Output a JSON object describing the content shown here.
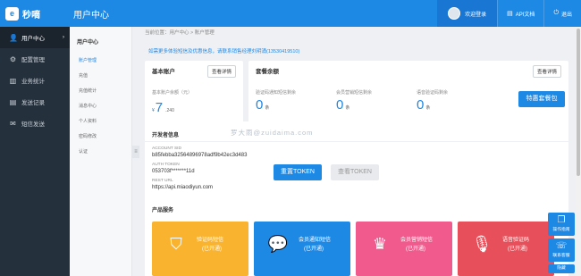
{
  "header": {
    "brand": "秒嘀",
    "logo_letter": "e",
    "title": "用户中心",
    "user_label": "欢迎登录",
    "api_label": "API文档",
    "logout_label": "退出",
    "bg_color": "#1e88e5"
  },
  "sidebar": {
    "items": [
      {
        "label": "用户中心",
        "icon": "user-icon"
      },
      {
        "label": "配置管理",
        "icon": "gear-icon"
      },
      {
        "label": "业务统计",
        "icon": "chart-icon"
      },
      {
        "label": "发送记录",
        "icon": "document-icon"
      },
      {
        "label": "短信发送",
        "icon": "send-icon"
      }
    ]
  },
  "submenu": {
    "title": "用户中心",
    "items": [
      "账户管理",
      "充值",
      "充值统计",
      "消息中心",
      "个人资料",
      "密码修改",
      "认证"
    ]
  },
  "breadcrumb": "当前位置：用户中心 > 账户管理",
  "notice": "如需更多体验短信及优惠信息，请联系销售经理刘玥涌(13530419510)",
  "basic_account": {
    "title": "基本账户",
    "view_details": "查看详情",
    "balance_label": "基本账户余额（元）",
    "currency": "¥",
    "balance_main": "7",
    "balance_fraction": ".240"
  },
  "package": {
    "title": "套餐余额",
    "view_details": "查看详情",
    "columns": [
      {
        "label": "验证码通知短信剩余",
        "value": "0",
        "unit": "条"
      },
      {
        "label": "会员营销短信剩余",
        "value": "0",
        "unit": "条"
      },
      {
        "label": "语音验证码剩余",
        "value": "0",
        "unit": "条"
      }
    ],
    "deal_button": "特惠套餐包"
  },
  "developer": {
    "title": "开发者信息",
    "account_sid_label": "ACCOUNT SID",
    "account_sid": "b85febba32564896978adf9b42ec3d483",
    "auth_token_label": "AUTH TOKEN",
    "auth_token": "053703f*******11d",
    "rest_url_label": "REST URL",
    "rest_url": "https://api.miaodiyun.com",
    "reset_button": "重置TOKEN",
    "view_button": "查看TOKEN"
  },
  "watermark": "罗大雨@zuidaima.com",
  "products": {
    "title": "产品服务",
    "tiles": [
      {
        "name": "验证码短信",
        "state": "(已开通)",
        "color": "#f9b32f",
        "icon": "shield-icon"
      },
      {
        "name": "会员通知短信",
        "state": "(已开通)",
        "color": "#1e88e5",
        "icon": "chat-icon"
      },
      {
        "name": "会员营销短信",
        "state": "(已开通)",
        "color": "#f05a8c",
        "icon": "crown-icon"
      },
      {
        "name": "语音验证码",
        "state": "(已开通)",
        "color": "#e7505a",
        "icon": "microphone-icon"
      }
    ]
  },
  "floating": {
    "guide_label": "操作指南",
    "contact_label": "联系客服",
    "hide_label": "隐藏"
  }
}
